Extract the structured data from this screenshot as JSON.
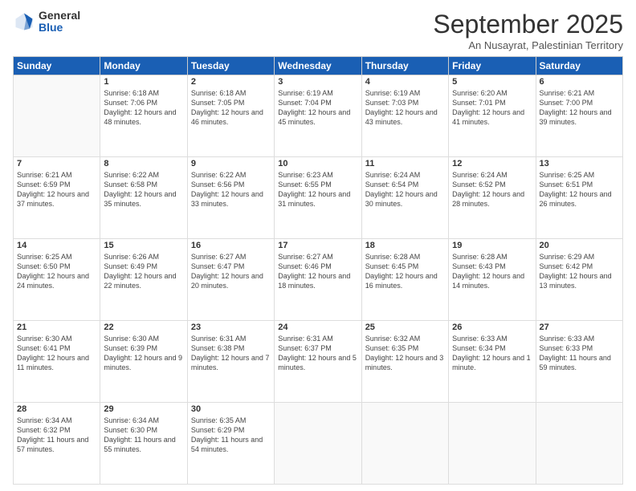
{
  "header": {
    "logo_general": "General",
    "logo_blue": "Blue",
    "month_title": "September 2025",
    "subtitle": "An Nusayrat, Palestinian Territory"
  },
  "weekdays": [
    "Sunday",
    "Monday",
    "Tuesday",
    "Wednesday",
    "Thursday",
    "Friday",
    "Saturday"
  ],
  "weeks": [
    [
      {
        "day": "",
        "sunrise": "",
        "sunset": "",
        "daylight": ""
      },
      {
        "day": "1",
        "sunrise": "Sunrise: 6:18 AM",
        "sunset": "Sunset: 7:06 PM",
        "daylight": "Daylight: 12 hours and 48 minutes."
      },
      {
        "day": "2",
        "sunrise": "Sunrise: 6:18 AM",
        "sunset": "Sunset: 7:05 PM",
        "daylight": "Daylight: 12 hours and 46 minutes."
      },
      {
        "day": "3",
        "sunrise": "Sunrise: 6:19 AM",
        "sunset": "Sunset: 7:04 PM",
        "daylight": "Daylight: 12 hours and 45 minutes."
      },
      {
        "day": "4",
        "sunrise": "Sunrise: 6:19 AM",
        "sunset": "Sunset: 7:03 PM",
        "daylight": "Daylight: 12 hours and 43 minutes."
      },
      {
        "day": "5",
        "sunrise": "Sunrise: 6:20 AM",
        "sunset": "Sunset: 7:01 PM",
        "daylight": "Daylight: 12 hours and 41 minutes."
      },
      {
        "day": "6",
        "sunrise": "Sunrise: 6:21 AM",
        "sunset": "Sunset: 7:00 PM",
        "daylight": "Daylight: 12 hours and 39 minutes."
      }
    ],
    [
      {
        "day": "7",
        "sunrise": "Sunrise: 6:21 AM",
        "sunset": "Sunset: 6:59 PM",
        "daylight": "Daylight: 12 hours and 37 minutes."
      },
      {
        "day": "8",
        "sunrise": "Sunrise: 6:22 AM",
        "sunset": "Sunset: 6:58 PM",
        "daylight": "Daylight: 12 hours and 35 minutes."
      },
      {
        "day": "9",
        "sunrise": "Sunrise: 6:22 AM",
        "sunset": "Sunset: 6:56 PM",
        "daylight": "Daylight: 12 hours and 33 minutes."
      },
      {
        "day": "10",
        "sunrise": "Sunrise: 6:23 AM",
        "sunset": "Sunset: 6:55 PM",
        "daylight": "Daylight: 12 hours and 31 minutes."
      },
      {
        "day": "11",
        "sunrise": "Sunrise: 6:24 AM",
        "sunset": "Sunset: 6:54 PM",
        "daylight": "Daylight: 12 hours and 30 minutes."
      },
      {
        "day": "12",
        "sunrise": "Sunrise: 6:24 AM",
        "sunset": "Sunset: 6:52 PM",
        "daylight": "Daylight: 12 hours and 28 minutes."
      },
      {
        "day": "13",
        "sunrise": "Sunrise: 6:25 AM",
        "sunset": "Sunset: 6:51 PM",
        "daylight": "Daylight: 12 hours and 26 minutes."
      }
    ],
    [
      {
        "day": "14",
        "sunrise": "Sunrise: 6:25 AM",
        "sunset": "Sunset: 6:50 PM",
        "daylight": "Daylight: 12 hours and 24 minutes."
      },
      {
        "day": "15",
        "sunrise": "Sunrise: 6:26 AM",
        "sunset": "Sunset: 6:49 PM",
        "daylight": "Daylight: 12 hours and 22 minutes."
      },
      {
        "day": "16",
        "sunrise": "Sunrise: 6:27 AM",
        "sunset": "Sunset: 6:47 PM",
        "daylight": "Daylight: 12 hours and 20 minutes."
      },
      {
        "day": "17",
        "sunrise": "Sunrise: 6:27 AM",
        "sunset": "Sunset: 6:46 PM",
        "daylight": "Daylight: 12 hours and 18 minutes."
      },
      {
        "day": "18",
        "sunrise": "Sunrise: 6:28 AM",
        "sunset": "Sunset: 6:45 PM",
        "daylight": "Daylight: 12 hours and 16 minutes."
      },
      {
        "day": "19",
        "sunrise": "Sunrise: 6:28 AM",
        "sunset": "Sunset: 6:43 PM",
        "daylight": "Daylight: 12 hours and 14 minutes."
      },
      {
        "day": "20",
        "sunrise": "Sunrise: 6:29 AM",
        "sunset": "Sunset: 6:42 PM",
        "daylight": "Daylight: 12 hours and 13 minutes."
      }
    ],
    [
      {
        "day": "21",
        "sunrise": "Sunrise: 6:30 AM",
        "sunset": "Sunset: 6:41 PM",
        "daylight": "Daylight: 12 hours and 11 minutes."
      },
      {
        "day": "22",
        "sunrise": "Sunrise: 6:30 AM",
        "sunset": "Sunset: 6:39 PM",
        "daylight": "Daylight: 12 hours and 9 minutes."
      },
      {
        "day": "23",
        "sunrise": "Sunrise: 6:31 AM",
        "sunset": "Sunset: 6:38 PM",
        "daylight": "Daylight: 12 hours and 7 minutes."
      },
      {
        "day": "24",
        "sunrise": "Sunrise: 6:31 AM",
        "sunset": "Sunset: 6:37 PM",
        "daylight": "Daylight: 12 hours and 5 minutes."
      },
      {
        "day": "25",
        "sunrise": "Sunrise: 6:32 AM",
        "sunset": "Sunset: 6:35 PM",
        "daylight": "Daylight: 12 hours and 3 minutes."
      },
      {
        "day": "26",
        "sunrise": "Sunrise: 6:33 AM",
        "sunset": "Sunset: 6:34 PM",
        "daylight": "Daylight: 12 hours and 1 minute."
      },
      {
        "day": "27",
        "sunrise": "Sunrise: 6:33 AM",
        "sunset": "Sunset: 6:33 PM",
        "daylight": "Daylight: 11 hours and 59 minutes."
      }
    ],
    [
      {
        "day": "28",
        "sunrise": "Sunrise: 6:34 AM",
        "sunset": "Sunset: 6:32 PM",
        "daylight": "Daylight: 11 hours and 57 minutes."
      },
      {
        "day": "29",
        "sunrise": "Sunrise: 6:34 AM",
        "sunset": "Sunset: 6:30 PM",
        "daylight": "Daylight: 11 hours and 55 minutes."
      },
      {
        "day": "30",
        "sunrise": "Sunrise: 6:35 AM",
        "sunset": "Sunset: 6:29 PM",
        "daylight": "Daylight: 11 hours and 54 minutes."
      },
      {
        "day": "",
        "sunrise": "",
        "sunset": "",
        "daylight": ""
      },
      {
        "day": "",
        "sunrise": "",
        "sunset": "",
        "daylight": ""
      },
      {
        "day": "",
        "sunrise": "",
        "sunset": "",
        "daylight": ""
      },
      {
        "day": "",
        "sunrise": "",
        "sunset": "",
        "daylight": ""
      }
    ]
  ]
}
